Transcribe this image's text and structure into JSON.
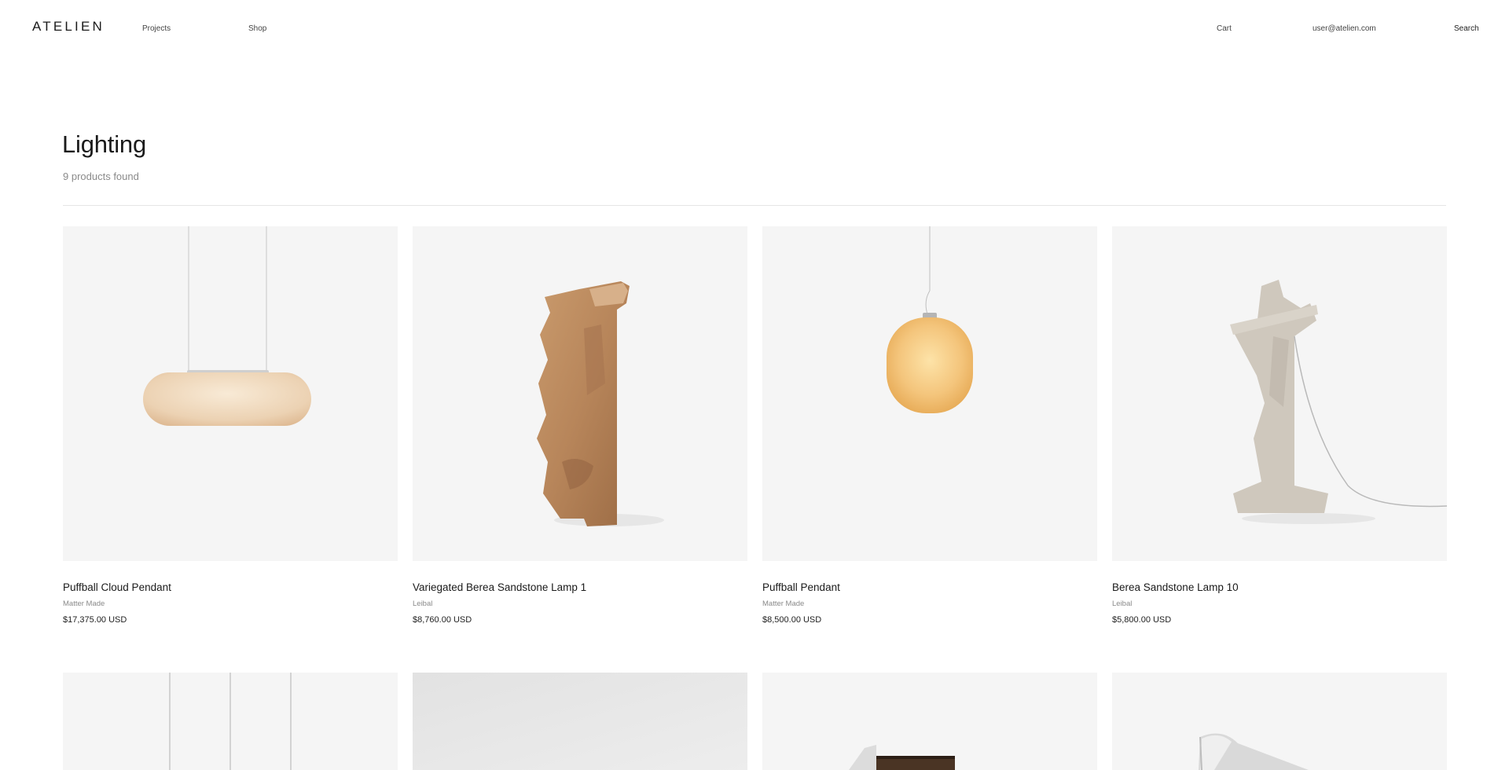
{
  "header": {
    "logo": "ATELIEN",
    "nav": {
      "projects": "Projects",
      "shop": "Shop"
    },
    "cart": "Cart",
    "user_email": "user@atelien.com",
    "search": "Search"
  },
  "page": {
    "title": "Lighting",
    "results_count": "9 products found"
  },
  "products": [
    {
      "name": "Puffball Cloud Pendant",
      "brand": "Matter Made",
      "price": "$17,375.00 USD"
    },
    {
      "name": "Variegated Berea Sandstone Lamp 1",
      "brand": "Leibal",
      "price": "$8,760.00 USD"
    },
    {
      "name": "Puffball Pendant",
      "brand": "Matter Made",
      "price": "$8,500.00 USD"
    },
    {
      "name": "Berea Sandstone Lamp 10",
      "brand": "Leibal",
      "price": "$5,800.00 USD"
    }
  ],
  "colors": {
    "tile_background": "#f5f5f5",
    "alabaster_glow": "#f3c57a",
    "sandstone": "#b88358",
    "grey_stone": "#cdc6bb"
  }
}
